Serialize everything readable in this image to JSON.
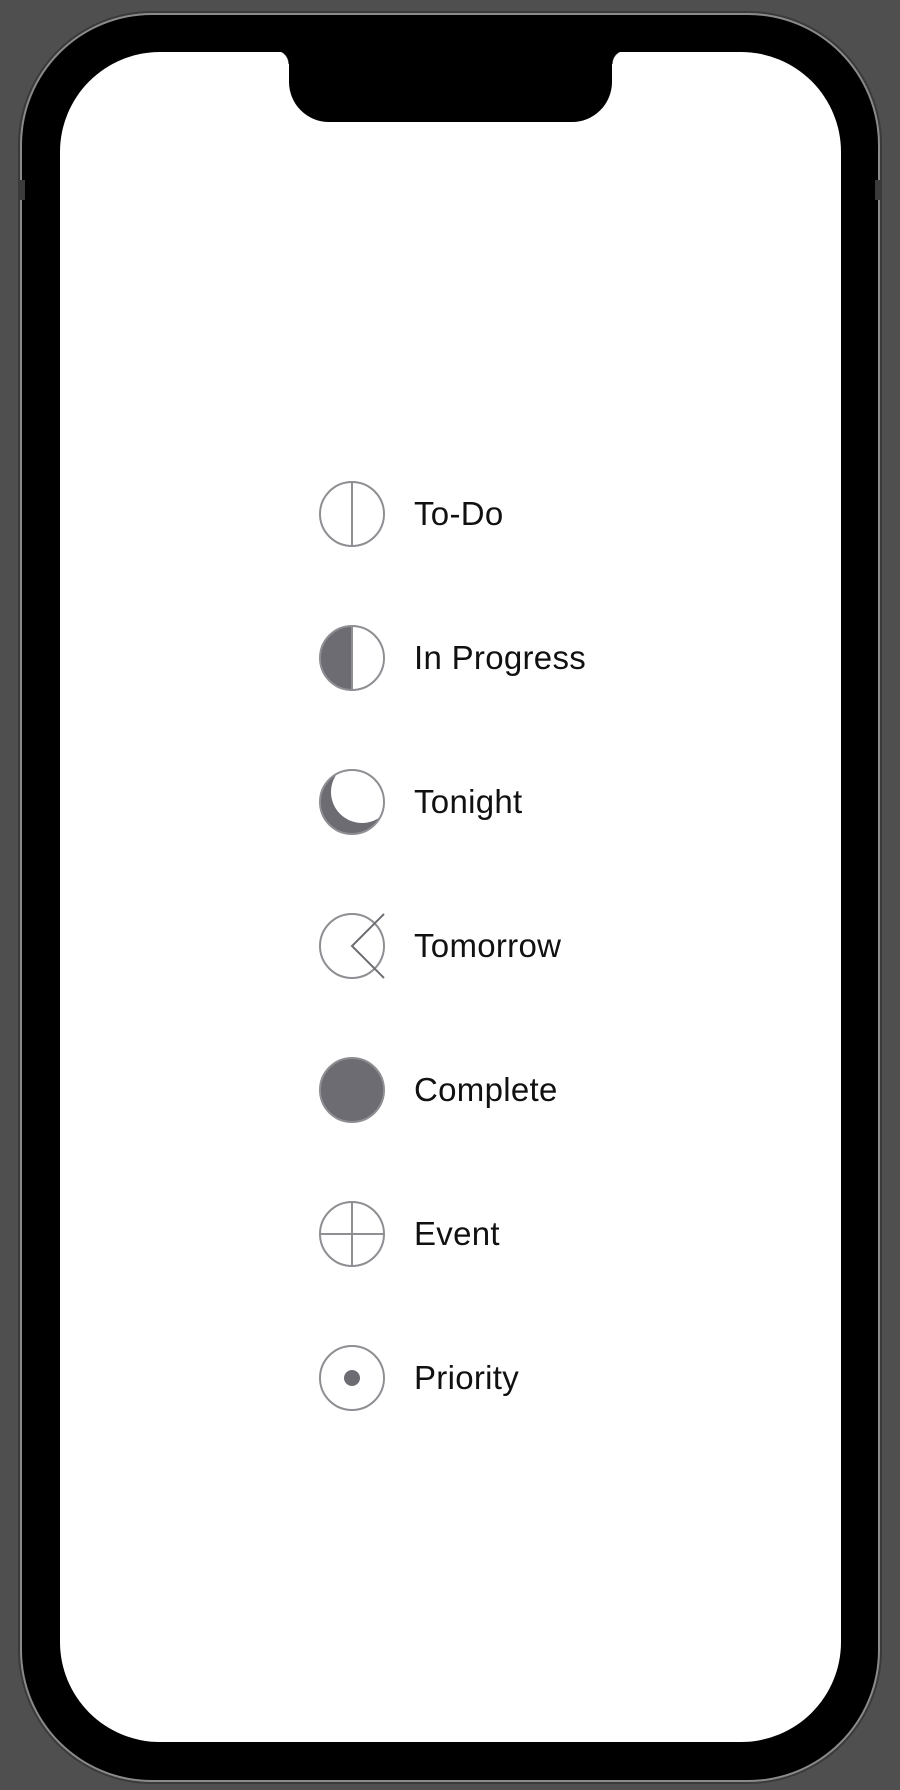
{
  "colors": {
    "icon_stroke": "#8e8e93",
    "icon_fill": "#6d6c72",
    "label_text": "#111111",
    "screen_bg": "#ffffff",
    "device_frame": "#000000",
    "backdrop": "#4f4f4f"
  },
  "legend": {
    "items": [
      {
        "label": "To-Do",
        "icon": "todo-half-circle-icon"
      },
      {
        "label": "In Progress",
        "icon": "in-progress-half-filled-icon"
      },
      {
        "label": "Tonight",
        "icon": "tonight-moon-icon"
      },
      {
        "label": "Tomorrow",
        "icon": "tomorrow-chevron-icon"
      },
      {
        "label": "Complete",
        "icon": "complete-filled-circle-icon"
      },
      {
        "label": "Event",
        "icon": "event-crosshair-icon"
      },
      {
        "label": "Priority",
        "icon": "priority-dot-icon"
      }
    ]
  }
}
